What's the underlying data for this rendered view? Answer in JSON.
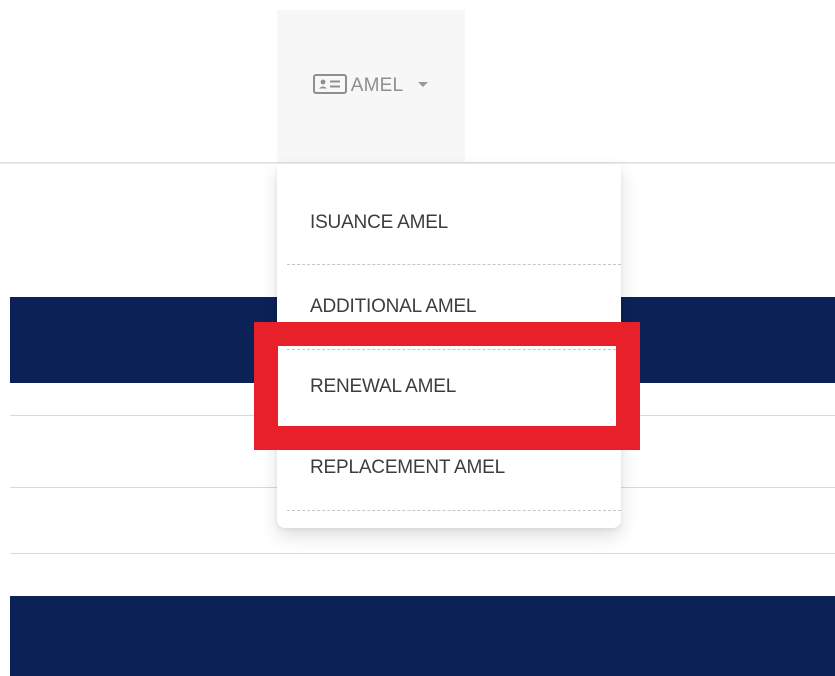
{
  "nav": {
    "label": "AMEL",
    "icon": "id-card-icon",
    "caret_icon": "caret-down-icon"
  },
  "dropdown": {
    "items": [
      {
        "label": "ISUANCE AMEL"
      },
      {
        "label": "ADDITIONAL AMEL"
      },
      {
        "label": "RENEWAL AMEL"
      },
      {
        "label": "REPLACEMENT AMEL"
      }
    ]
  },
  "colors": {
    "navy": "#0c2257",
    "highlight": "#e8202a",
    "tab_bg": "#f7f7f7"
  }
}
